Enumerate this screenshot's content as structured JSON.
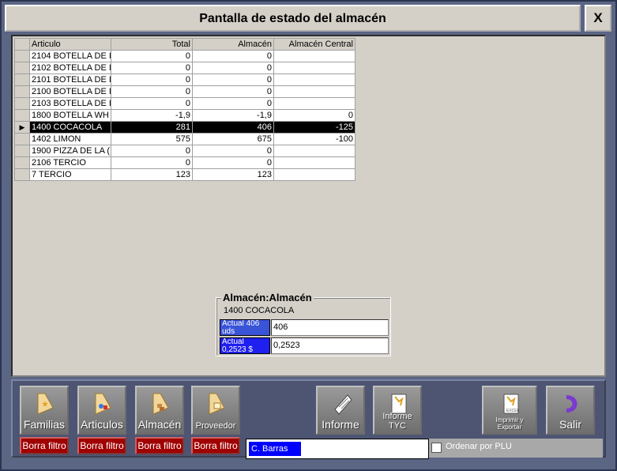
{
  "window": {
    "title": "Pantalla de estado del almacén",
    "close_label": "X"
  },
  "grid": {
    "headers": [
      "Articulo",
      "Total",
      "Almacén",
      "Almacén Central"
    ],
    "rows": [
      [
        "2104 BOTELLA DE I",
        "0",
        "0",
        ""
      ],
      [
        "2102 BOTELLA DE I",
        "0",
        "0",
        ""
      ],
      [
        "2101 BOTELLA DE I",
        "0",
        "0",
        ""
      ],
      [
        "2100 BOTELLA DE I",
        "0",
        "0",
        ""
      ],
      [
        "2103 BOTELLA DE I",
        "0",
        "0",
        ""
      ],
      [
        "1800 BOTELLA WH",
        "-1,9",
        "-1,9",
        "0"
      ],
      [
        "1400 COCACOLA",
        "281",
        "406",
        "-125"
      ],
      [
        "1402 LIMON",
        "575",
        "675",
        "-100"
      ],
      [
        "1900 PIZZA DE LA (",
        "0",
        "0",
        ""
      ],
      [
        "2106 TERCIO",
        "0",
        "0",
        ""
      ],
      [
        "7 TERCIO",
        "123",
        "123",
        ""
      ]
    ],
    "selected_row_index": 6,
    "selected_indicator": "▶"
  },
  "detail": {
    "title": "Almacén:Almacén",
    "product": "1400 COCACOLA",
    "rows": [
      {
        "label": "Actual 406 uds",
        "value": "406"
      },
      {
        "label": "Actual 0,2523 $",
        "value": "0,2523"
      }
    ]
  },
  "toolbar": {
    "familias": "Familias",
    "articulos": "Articulos",
    "almacen": "Almacén",
    "proveedor": "Proveedor",
    "informe": "Informe",
    "informe_tyc": "Informe TYC",
    "imprimir_exportar": "Imprimir y Exportar",
    "salir": "Salir",
    "borra_filtro": "Borra filtro"
  },
  "barcode": {
    "label": "C. Barras",
    "value": ""
  },
  "plu": {
    "label": "Ordenar por PLU",
    "checked": false
  },
  "colors": {
    "selected_row_bg": "#000000",
    "filter_button_bg": "#a00000",
    "barcode_label_bg": "#0000ff"
  }
}
